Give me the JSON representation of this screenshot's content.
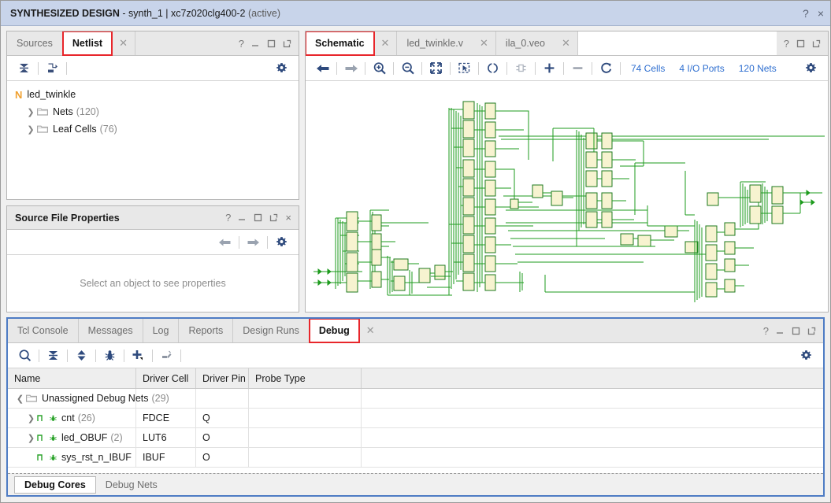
{
  "titlebar": {
    "prefix": "SYNTHESIZED DESIGN",
    "middle": " - synth_1 | xc7z020clg400-2",
    "state": "(active)",
    "help_icon": "?",
    "close_icon": "×"
  },
  "netlist_panel": {
    "tabs": [
      {
        "label": "Sources",
        "active": false,
        "highlighted": false
      },
      {
        "label": "Netlist",
        "active": true,
        "highlighted": true
      }
    ],
    "controls": [
      "?",
      "—",
      "□",
      "↗"
    ],
    "toolbar": [
      {
        "name": "collapse-all-icon"
      },
      {
        "name": "expand-branch-icon"
      },
      {
        "name": "settings-gear-icon"
      }
    ],
    "tree": [
      {
        "label": "led_twinkle",
        "count": "",
        "level": 0,
        "type": "module",
        "expandable": false
      },
      {
        "label": "Nets",
        "count": "(120)",
        "level": 1,
        "type": "folder",
        "expandable": true
      },
      {
        "label": "Leaf Cells",
        "count": "(76)",
        "level": 1,
        "type": "folder",
        "expandable": true
      }
    ]
  },
  "properties_panel": {
    "title": "Source File Properties",
    "controls": [
      "?",
      "—",
      "□",
      "↗",
      "×"
    ],
    "toolbar": [
      {
        "name": "back-arrow-icon"
      },
      {
        "name": "forward-arrow-icon"
      },
      {
        "name": "settings-gear-icon"
      }
    ],
    "empty_message": "Select an object to see properties"
  },
  "schematic_panel": {
    "tabs": [
      {
        "label": "Schematic",
        "active": true,
        "highlighted": true,
        "closable": true
      },
      {
        "label": "led_twinkle.v",
        "active": false,
        "highlighted": false,
        "closable": true
      },
      {
        "label": "ila_0.veo",
        "active": false,
        "highlighted": false,
        "closable": true
      }
    ],
    "controls": [
      "?",
      "□",
      "↗"
    ],
    "toolbar_icons": [
      "back-arrow-icon",
      "forward-arrow-icon",
      "zoom-in-icon",
      "zoom-out-icon",
      "zoom-fit-icon",
      "zoom-area-icon",
      "highlight-icon",
      "pin-icon",
      "expand-plus-icon",
      "collapse-minus-icon",
      "refresh-icon"
    ],
    "stats": [
      {
        "label": "74 Cells"
      },
      {
        "label": "4 I/O Ports"
      },
      {
        "label": "120 Nets"
      }
    ],
    "gear": "settings-gear-icon"
  },
  "debug_panel": {
    "tabs": [
      {
        "label": "Tcl Console",
        "active": false,
        "highlighted": false
      },
      {
        "label": "Messages",
        "active": false,
        "highlighted": false
      },
      {
        "label": "Log",
        "active": false,
        "highlighted": false
      },
      {
        "label": "Reports",
        "active": false,
        "highlighted": false
      },
      {
        "label": "Design Runs",
        "active": false,
        "highlighted": false
      },
      {
        "label": "Debug",
        "active": true,
        "highlighted": true
      }
    ],
    "controls": [
      "?",
      "—",
      "□",
      "↗"
    ],
    "toolbar_icons": [
      "search-icon",
      "collapse-all-icon",
      "expand-collapse-icon",
      "debug-bug-icon",
      "add-plus-icon",
      "create-debug-core-icon"
    ],
    "gear": "settings-gear-icon",
    "columns": [
      "Name",
      "Driver Cell",
      "Driver Pin",
      "Probe Type"
    ],
    "rows": [
      {
        "name": "Unassigned Debug Nets",
        "count": "(29)",
        "driver_cell": "",
        "driver_pin": "",
        "probe_type": "",
        "level": 0,
        "type": "folder",
        "expanded": true,
        "expandable": true
      },
      {
        "name": "cnt",
        "count": "(26)",
        "driver_cell": "FDCE",
        "driver_pin": "Q",
        "probe_type": "",
        "level": 1,
        "type": "net",
        "expanded": false,
        "expandable": true
      },
      {
        "name": "led_OBUF",
        "count": "(2)",
        "driver_cell": "LUT6",
        "driver_pin": "O",
        "probe_type": "",
        "level": 1,
        "type": "net",
        "expanded": false,
        "expandable": true
      },
      {
        "name": "sys_rst_n_IBUF",
        "count": "",
        "driver_cell": "IBUF",
        "driver_pin": "O",
        "probe_type": "",
        "level": 1,
        "type": "net",
        "expanded": false,
        "expandable": false
      }
    ],
    "subtabs": [
      {
        "label": "Debug Cores",
        "active": true
      },
      {
        "label": "Debug Nets",
        "active": false
      }
    ]
  },
  "colors": {
    "title_bar": "#c8d4ea",
    "highlight_red": "#e8262b",
    "focus_blue": "#4e7cc4",
    "link_blue": "#2f6fd0",
    "icon_navy": "#3a4f7a",
    "schematic_wire": "#1d9b1d",
    "schematic_cell_fill": "#f7f3d0",
    "schematic_cell_stroke": "#1d7a1d",
    "module_badge": "#f0a030"
  }
}
